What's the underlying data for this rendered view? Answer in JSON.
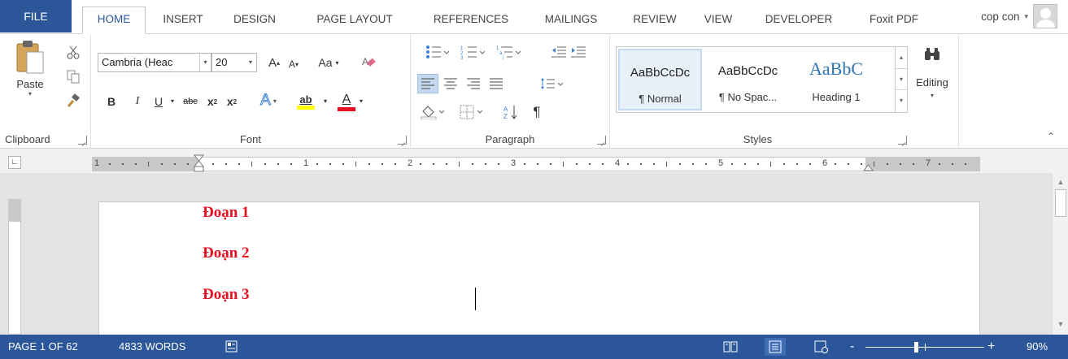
{
  "tabs": {
    "file": "FILE",
    "home": "HOME",
    "insert": "INSERT",
    "design": "DESIGN",
    "page_layout": "PAGE LAYOUT",
    "references": "REFERENCES",
    "mailings": "MAILINGS",
    "review": "REVIEW",
    "view": "VIEW",
    "developer": "DEVELOPER",
    "foxit": "Foxit PDF"
  },
  "user": {
    "name": "cop con",
    "caret": "▾"
  },
  "clipboard": {
    "label": "Clipboard",
    "paste": "Paste"
  },
  "font": {
    "label": "Font",
    "family": "Cambria (Heac",
    "size": "20",
    "grow": "A",
    "shrink": "A",
    "change_case": "Aa",
    "bold": "B",
    "italic": "I",
    "underline": "U",
    "strikethrough": "abc",
    "subscript": "x",
    "superscript": "x",
    "effects": "A",
    "highlight": "ab",
    "color": "A"
  },
  "paragraph": {
    "label": "Paragraph",
    "pilcrow": "¶"
  },
  "styles": {
    "label": "Styles",
    "items": [
      {
        "sample": "AaBbCcDc",
        "name": "¶ Normal"
      },
      {
        "sample": "AaBbCcDc",
        "name": "¶ No Spac..."
      },
      {
        "sample": "AaBbC",
        "name": "Heading 1"
      }
    ]
  },
  "editing": {
    "label": "Editing"
  },
  "ruler": {
    "numbers": [
      "1",
      "1",
      "2",
      "3",
      "4",
      "5",
      "6",
      "7"
    ]
  },
  "document": {
    "headings": [
      "Đoạn 1",
      "Đoạn 2",
      "Đoạn 3"
    ],
    "heading_color": "#e81123"
  },
  "status": {
    "page": "PAGE 1 OF 62",
    "words": "4833 WORDS",
    "zoom": "90%",
    "zoom_minus": "-",
    "zoom_plus": "+"
  },
  "colors": {
    "accent": "#2b579a",
    "highlight_yellow": "#ffff00",
    "font_red": "#e81123"
  }
}
